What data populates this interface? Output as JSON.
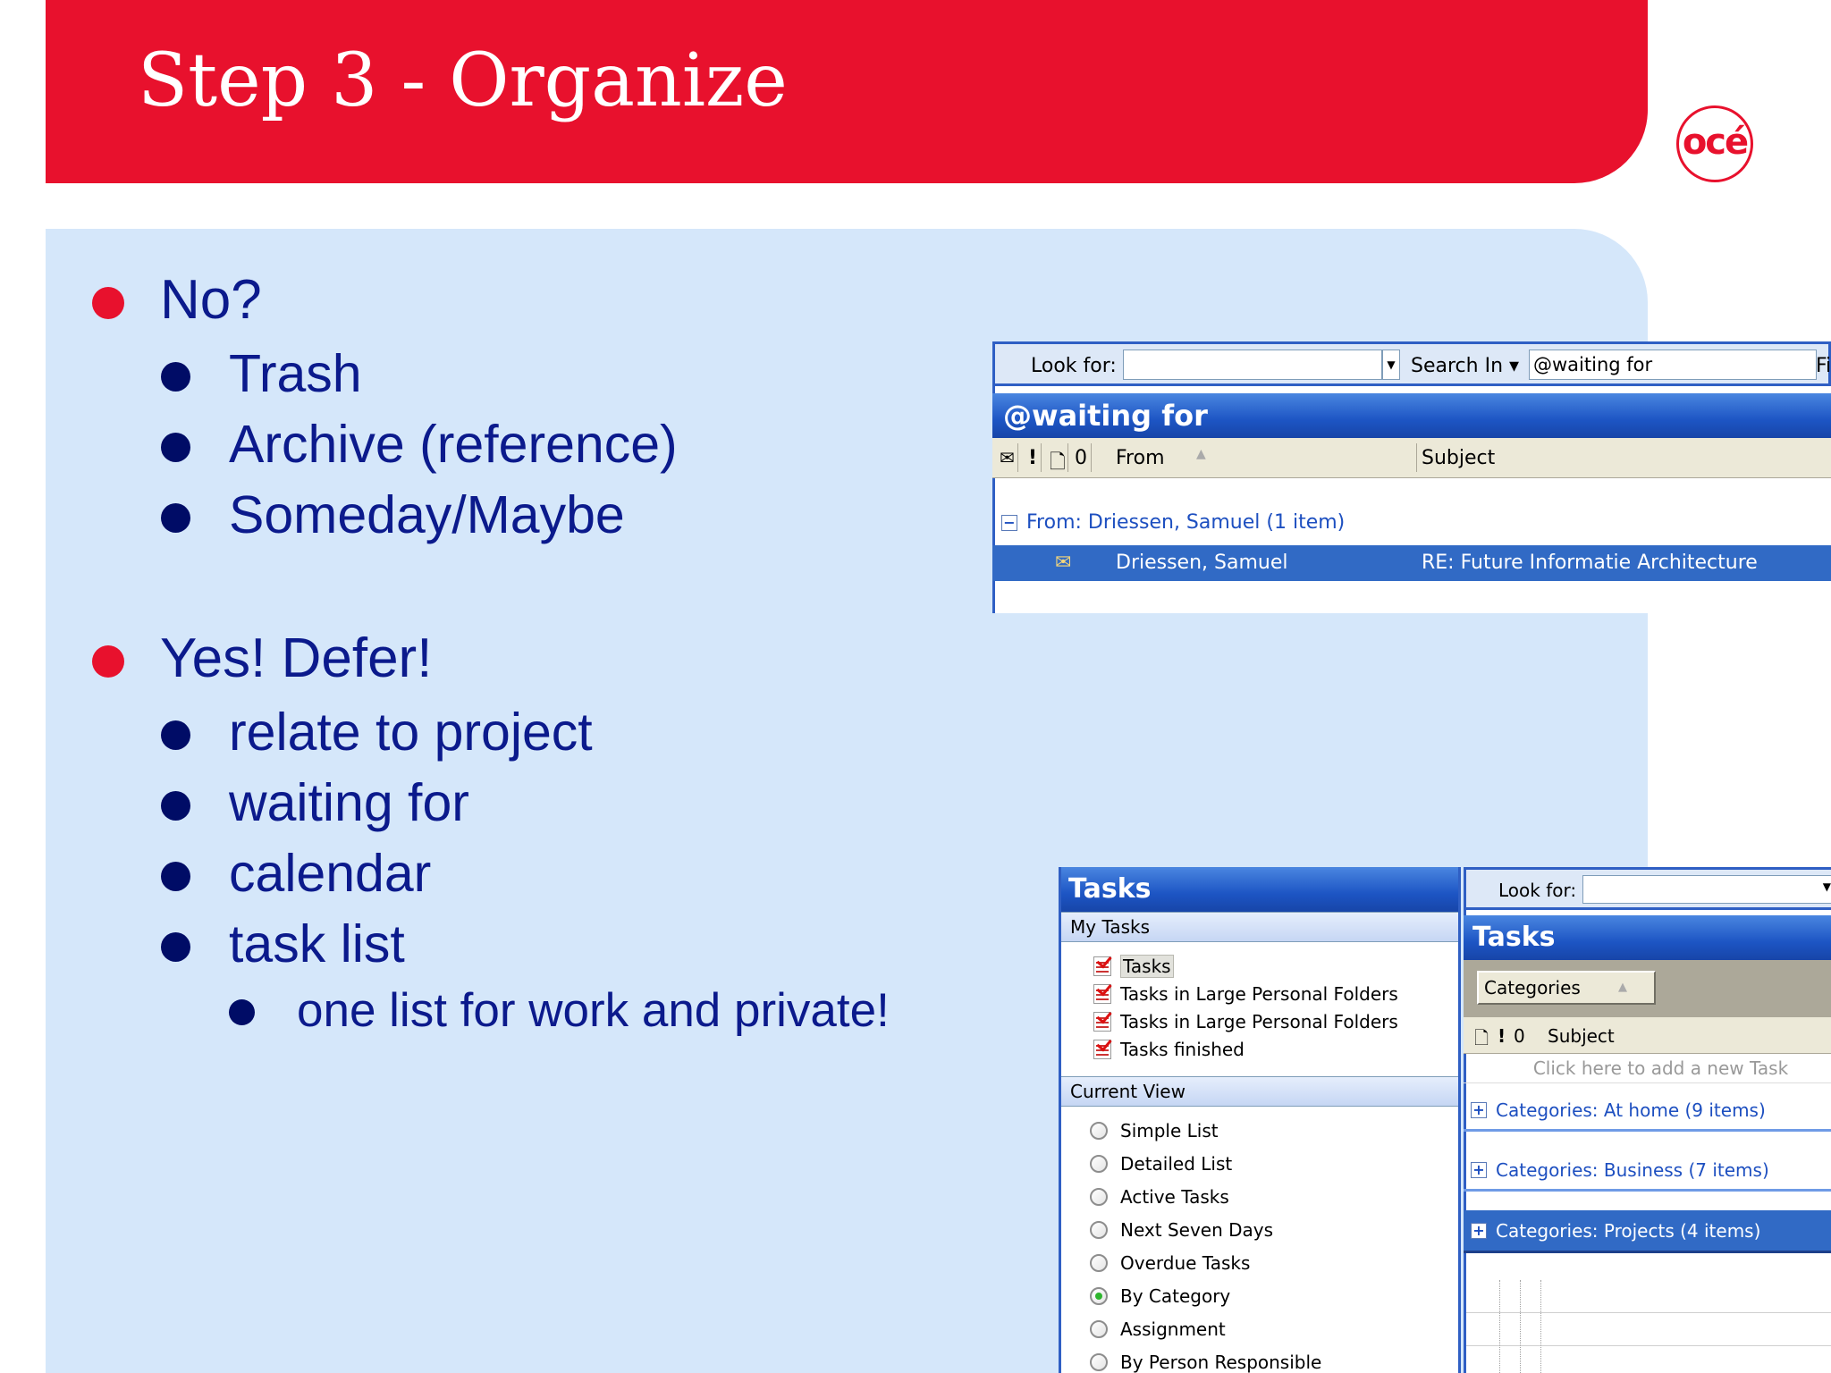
{
  "slide": {
    "title": "Step 3 - Organize",
    "logo": "océ",
    "colors": {
      "brand_red": "#e8112d",
      "panel_bg": "#d5e7fa",
      "text_blue": "#0b1a8c",
      "outlook_blue": "#316ac5"
    }
  },
  "bullets": [
    {
      "level": 1,
      "text": "No?"
    },
    {
      "level": 2,
      "text": "Trash"
    },
    {
      "level": 2,
      "text": "Archive (reference)"
    },
    {
      "level": 2,
      "text": "Someday/Maybe"
    },
    {
      "level": 1,
      "text": "Yes! Defer!"
    },
    {
      "level": 2,
      "text": "relate to project"
    },
    {
      "level": 2,
      "text": "waiting for"
    },
    {
      "level": 2,
      "text": "calendar"
    },
    {
      "level": 2,
      "text": "task list"
    },
    {
      "level": 3,
      "text": "one list for work and private!"
    }
  ],
  "waiting_shot": {
    "look_for_label": "Look for:",
    "look_for_value": "",
    "search_in_label": "Search In ▾",
    "search_in_value": "@waiting for",
    "find_button_partial": "Fi",
    "folder_title": "@waiting for",
    "columns": {
      "from": "From",
      "subject": "Subject"
    },
    "group_label": "From: Driessen, Samuel (1 item)",
    "message": {
      "from": "Driessen, Samuel",
      "subject": "RE: Future Informatie Architecture"
    }
  },
  "tasks_nav": {
    "title": "Tasks",
    "my_tasks_label": "My Tasks",
    "my_tasks": [
      "Tasks",
      "Tasks in Large Personal Folders",
      "Tasks in Large Personal Folders",
      "Tasks finished"
    ],
    "selected_task_folder": 0,
    "current_view_label": "Current View",
    "views": [
      "Simple List",
      "Detailed List",
      "Active Tasks",
      "Next Seven Days",
      "Overdue Tasks",
      "By Category",
      "Assignment",
      "By Person Responsible"
    ],
    "selected_view": 5
  },
  "tasks_list": {
    "look_for_label": "Look for:",
    "look_for_value": "",
    "title": "Tasks",
    "group_by_label": "Categories",
    "subject_header": "Subject",
    "add_new_placeholder": "Click here to add a new Task",
    "categories": [
      {
        "label": "Categories: At home (9 items)",
        "selected": false
      },
      {
        "label": "Categories: Business (7 items)",
        "selected": false
      },
      {
        "label": "Categories: Projects (4 items)",
        "selected": true
      }
    ]
  }
}
